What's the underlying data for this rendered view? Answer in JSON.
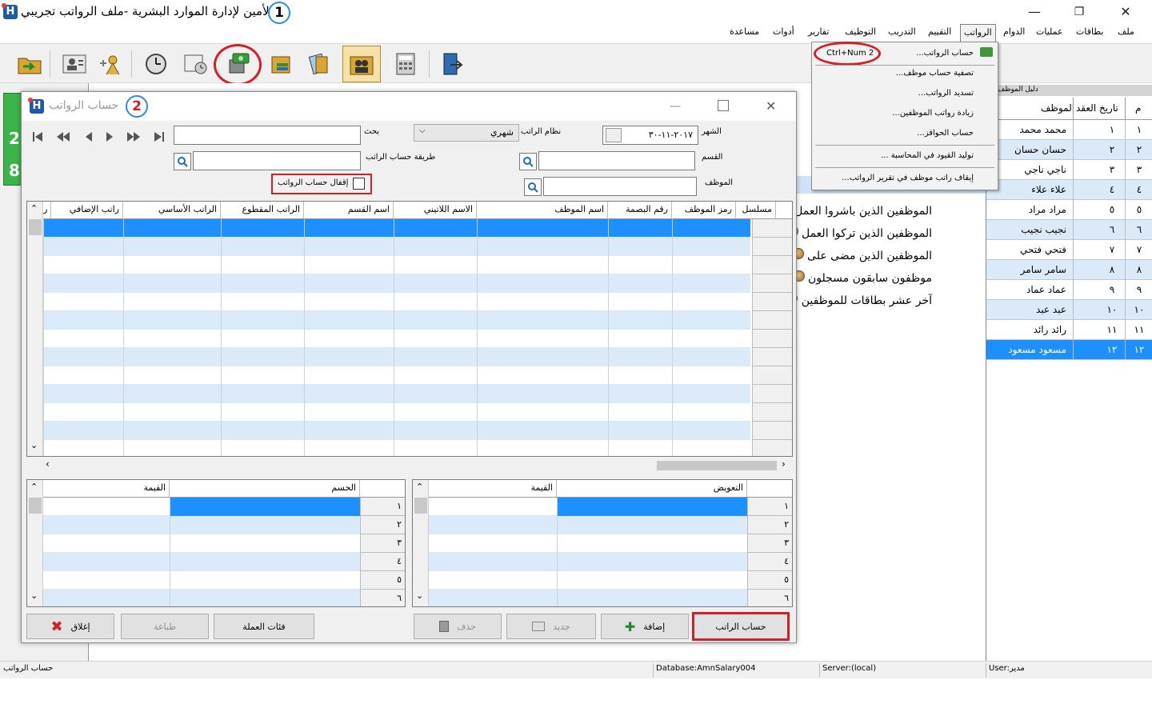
{
  "app": {
    "title": "الأمين لإدارة الموارد البشرية -ملف الرواتب تجريبي",
    "logo_letter": "H",
    "callout_1": "1",
    "callout_2": "2"
  },
  "window_controls": {
    "minimize": "—",
    "maximize": "❐",
    "close": "✕"
  },
  "menu": [
    "ملف",
    "بطاقات",
    "عمليات",
    "الدوام",
    "الرواتب",
    "التقييم",
    "التدريب",
    "التوظيف",
    "تقارير",
    "أدوات",
    "مساعدة"
  ],
  "dropdown": {
    "items": [
      {
        "label": "حساب الرواتب...",
        "shortcut": "Ctrl+Num 2"
      },
      {
        "label": "تصفية حساب موظف..."
      },
      {
        "label": "تسديد الرواتب..."
      },
      {
        "label": "زيادة رواتب الموظفين..."
      },
      {
        "label": "حساب الحوافز..."
      },
      {
        "label": "توليد القيود في المحاسبة ..."
      },
      {
        "label": "إيقاف راتب موظف في تقرير الرواتب..."
      }
    ]
  },
  "side_panel": {
    "title": "دليل الموظف",
    "close": "×",
    "columns": {
      "index": "م",
      "contract_date": "تاريخ العقد",
      "employee": "الموظف"
    },
    "rows": [
      {
        "idx": "١",
        "num": "١",
        "name": "محمد محمد"
      },
      {
        "idx": "٢",
        "num": "٢",
        "name": "حسان حسان"
      },
      {
        "idx": "٣",
        "num": "٣",
        "name": "ناجي ناجي"
      },
      {
        "idx": "٤",
        "num": "٤",
        "name": "علاء علاء"
      },
      {
        "idx": "٥",
        "num": "٥",
        "name": "مراد مراد"
      },
      {
        "idx": "٦",
        "num": "٦",
        "name": "نجيب نجيب"
      },
      {
        "idx": "٧",
        "num": "٧",
        "name": "فتحي فتحي"
      },
      {
        "idx": "٨",
        "num": "٨",
        "name": "سامر سامر"
      },
      {
        "idx": "٩",
        "num": "٩",
        "name": "عماد عماد"
      },
      {
        "idx": "١٠",
        "num": "١٠",
        "name": "عبد عبد"
      },
      {
        "idx": "١١",
        "num": "١١",
        "name": "رائد رائد"
      },
      {
        "idx": "١٢",
        "num": "١٢",
        "name": "مسعود مسعود"
      }
    ]
  },
  "background_links": [
    "الموظفين الذين باشروا العمل",
    "الموظفين الذين تركوا العمل",
    "الموظفين الذين مضى على",
    "موظفون سابقون مسجلون",
    "آخر عشر بطاقات للموظفين"
  ],
  "green_box": {
    "top": "2",
    "bottom": "8"
  },
  "dialog": {
    "title": "حساب الرواتب",
    "month_label": "الشهر",
    "month_value": "٢٠١٧-١١-٣٠",
    "salary_system_label": "نظام الراتب",
    "salary_system_value": "شهري",
    "search_label": "بحث",
    "search_value": "",
    "department_label": "القسم",
    "calc_method_label": "طريقة حساب الراتب",
    "employee_label": "الموظف",
    "lock_label": "إقفال حساب الرواتب",
    "main_columns": [
      "مسلسل",
      "رمز الموظف",
      "رقم البصمة",
      "اسم الموظف",
      "الاسم اللاتيني",
      "اسم القسم",
      "الراتب المقطوع",
      "الراتب الأساسي",
      "راتب الإضافي",
      "ر"
    ],
    "allowance_columns": {
      "name": "التعويض",
      "value": "القيمة"
    },
    "deduction_columns": {
      "name": "الحسم",
      "value": "القيمة"
    },
    "row_numbers": [
      "١",
      "٢",
      "٣",
      "٤",
      "٥",
      "٦"
    ],
    "buttons": {
      "calc": "حساب الراتب",
      "add": "إضافة",
      "new": "جديد",
      "delete": "حذف",
      "currency": "فئات العملة",
      "print": "طباعة",
      "close": "إغلاق"
    }
  },
  "status_bar": {
    "left": "حساب الرواتب",
    "database": "Database:AmnSalary004",
    "server": "Server:(local)",
    "user": "User:مدير"
  }
}
